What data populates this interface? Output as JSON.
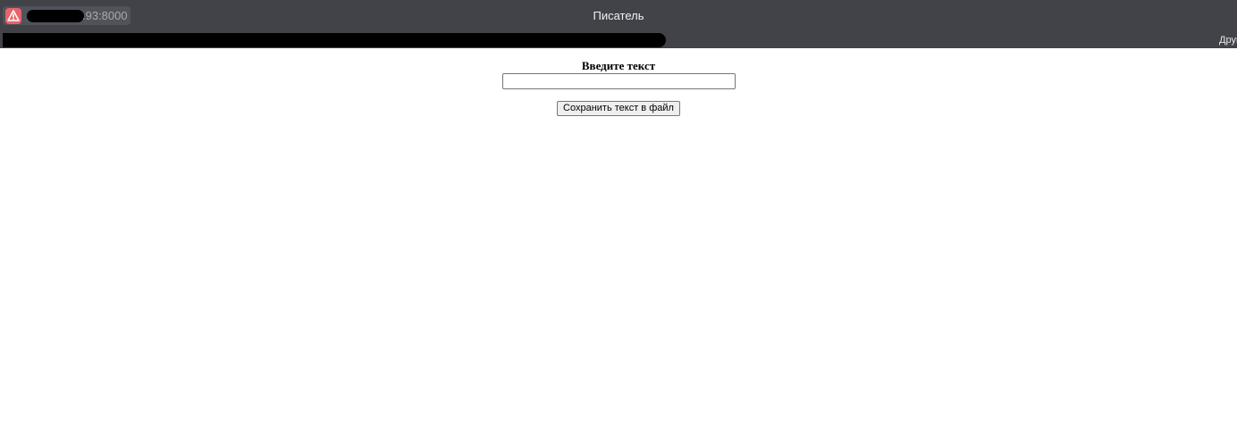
{
  "browser": {
    "address_suffix": ".93:8000",
    "window_title": "Писатель",
    "bookmarks_other": "Другие закладки",
    "warning_icon": "warning-triangle-icon",
    "warning_color": "#e8636b",
    "bar_color": "#424249"
  },
  "form": {
    "label": "Введите текст",
    "input_value": "",
    "save_label": "Сохранить текст в файл"
  }
}
